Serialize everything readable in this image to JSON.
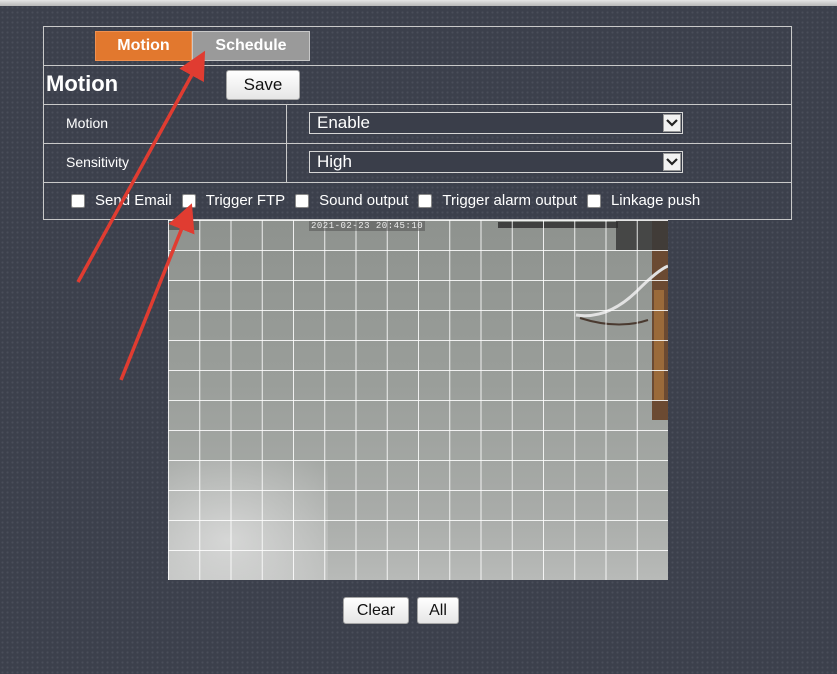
{
  "tabs": {
    "motion_label": "Motion",
    "schedule_label": "Schedule"
  },
  "section": {
    "title": "Motion",
    "save_label": "Save"
  },
  "rows": {
    "motion": {
      "label": "Motion",
      "value": "Enable"
    },
    "sensitivity": {
      "label": "Sensitivity",
      "value": "High"
    }
  },
  "checkboxes": [
    {
      "label": "Send Email",
      "checked": false
    },
    {
      "label": "Trigger FTP",
      "checked": false
    },
    {
      "label": "Sound output",
      "checked": false
    },
    {
      "label": "Trigger alarm output",
      "checked": false
    },
    {
      "label": "Linkage push",
      "checked": false
    }
  ],
  "video": {
    "timestamp": "2021-02-23 20:45:10"
  },
  "actions": {
    "clear_label": "Clear",
    "all_label": "All"
  },
  "colors": {
    "active_tab": "#e2782e",
    "inactive_tab": "#9a9a9a",
    "annotation_arrow": "#e03c31"
  },
  "icons": {
    "dropdown": "chevron-down-icon",
    "annotation": "arrow-icon"
  }
}
